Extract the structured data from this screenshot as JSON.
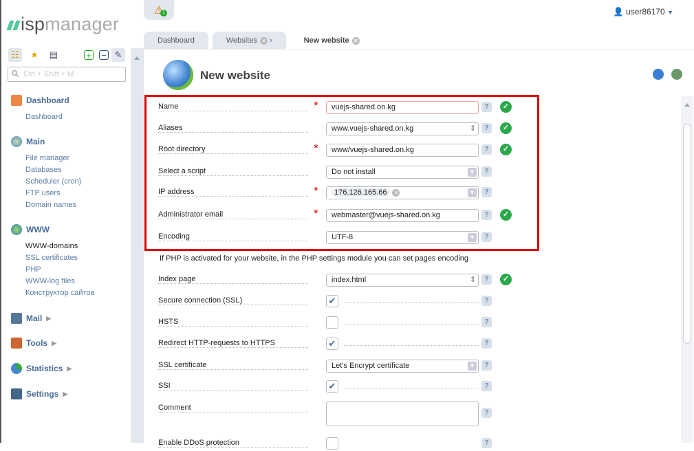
{
  "app": {
    "logo_prefix": "isp",
    "logo_suffix": "manager"
  },
  "header": {
    "alert_count": "1",
    "user": "user86170"
  },
  "tabs": [
    {
      "label": "Dashboard"
    },
    {
      "label": "Websites"
    },
    {
      "label": "New website"
    }
  ],
  "sidebar": {
    "search_placeholder": "Ctrl + Shift + M",
    "groups": [
      {
        "label": "Dashboard",
        "items": [
          "Dashboard"
        ]
      },
      {
        "label": "Main",
        "items": [
          "File manager",
          "Databases",
          "Scheduler (cron)",
          "FTP users",
          "Domain names"
        ]
      },
      {
        "label": "WWW",
        "items": [
          "WWW-domains",
          "SSL certificates",
          "PHP",
          "WWW-log files",
          "Конструктор сайтов"
        ]
      },
      {
        "label": "Mail"
      },
      {
        "label": "Tools"
      },
      {
        "label": "Statistics"
      },
      {
        "label": "Settings"
      }
    ]
  },
  "form": {
    "title": "New website",
    "fields": [
      {
        "label": "Name",
        "value": "vuejs-shared.on.kg"
      },
      {
        "label": "Aliases",
        "value": "www.vuejs-shared.on.kg"
      },
      {
        "label": "Root directory",
        "value": "www/vuejs-shared.on.kg"
      },
      {
        "label": "Select a script",
        "value": "Do not install"
      },
      {
        "label": "IP address",
        "value": "176.126.165.66"
      },
      {
        "label": "Administrator email",
        "value": "webmaster@vuejs-shared.on.kg"
      },
      {
        "label": "Encoding",
        "value": "UTF-8"
      }
    ],
    "note": "If PHP is activated for your website, in the PHP settings module you can set pages encoding",
    "fields2": [
      {
        "label": "Index page",
        "value": "index.html"
      },
      {
        "label": "Secure connection (SSL)",
        "checked": true
      },
      {
        "label": "HSTS",
        "checked": false
      },
      {
        "label": "Redirect HTTP-requests to HTTPS",
        "checked": true
      },
      {
        "label": "SSL certificate",
        "value": "Let's Encrypt certificate"
      },
      {
        "label": "SSI",
        "checked": true
      },
      {
        "label": "Comment",
        "value": ""
      },
      {
        "label": "Enable DDoS protection",
        "checked": false
      }
    ]
  },
  "colors": {
    "accent": "#4a6d99",
    "highlight": "#e00000",
    "ok": "#2aa84a"
  }
}
